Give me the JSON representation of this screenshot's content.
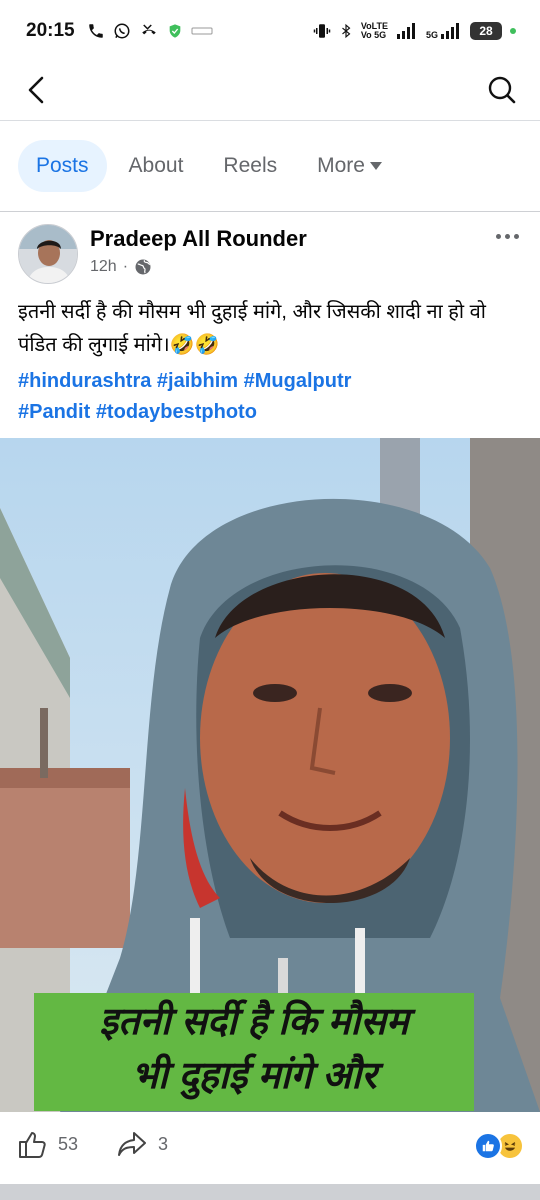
{
  "status_bar": {
    "time": "20:15",
    "network_top": "VoLTE",
    "network_bottom": "Vo 5G",
    "network_5g": "5G",
    "battery": "28"
  },
  "nav": {
    "back_icon": "chevron-left-icon",
    "search_icon": "search-icon"
  },
  "tabs": [
    {
      "label": "Posts",
      "active": true
    },
    {
      "label": "About",
      "active": false
    },
    {
      "label": "Reels",
      "active": false
    },
    {
      "label": "More",
      "active": false
    }
  ],
  "post": {
    "author": "Pradeep All Rounder",
    "time": "12h",
    "separator": "·",
    "audience_icon": "globe-icon",
    "text": "इतनी सर्दी है की मौसम भी दुहाई मांगे, और जिसकी शादी ना हो वो पंडित की लुगाई मांगे।🤣🤣",
    "hashtags": [
      "#hindurashtra",
      "#jaibhim",
      "#Mugalputr",
      "#Pandit",
      "#todaybestphoto"
    ],
    "photo_caption_line1": "इतनी सर्दी है कि मौसम",
    "photo_caption_line2": "भी दुहाई मांगे और",
    "likes": "53",
    "shares": "3"
  },
  "colors": {
    "accent": "#1b74e4",
    "tab_active_bg": "#e7f3ff",
    "caption_green": "#63b843"
  }
}
